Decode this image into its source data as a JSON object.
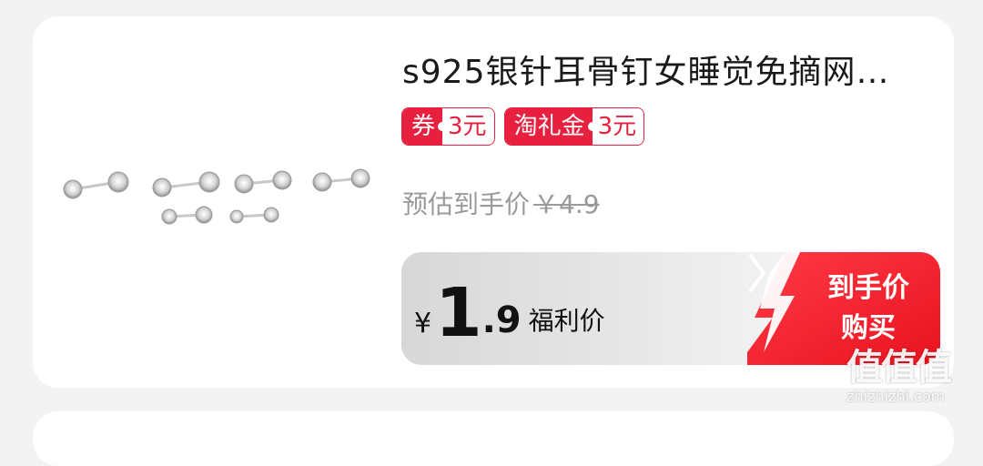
{
  "product": {
    "title": "s925银针耳骨钉女睡觉免摘网…",
    "image_alt": "earring-studs-image"
  },
  "coupons": [
    {
      "key": "券",
      "value": "3元"
    },
    {
      "key": "淘礼金",
      "value": "3元"
    }
  ],
  "estimate": {
    "label": "预估到手价",
    "old_price": "￥4.9"
  },
  "buy_bar": {
    "currency": "¥",
    "price_int": "1",
    "price_dec": ".9",
    "price_label": "福利价",
    "cta_line1": "到手价",
    "cta_line2": "购买"
  },
  "watermark": {
    "logo": "值值值",
    "url": "zhizhizhi.com"
  },
  "colors": {
    "accent": "#e8203f",
    "cta_red": "#f01e33"
  }
}
